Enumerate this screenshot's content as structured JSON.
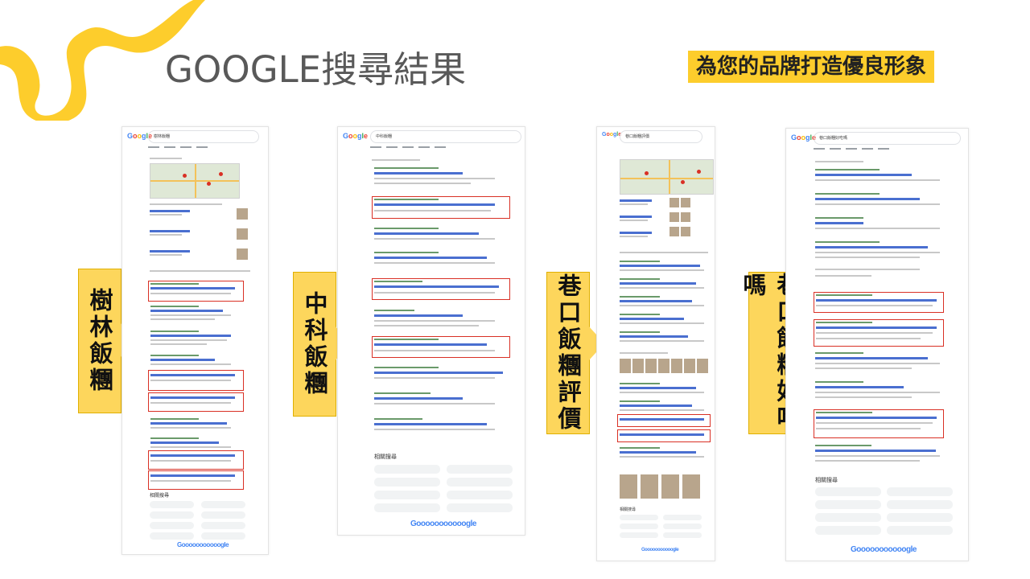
{
  "header": {
    "title": "GOOGLE搜尋結果",
    "tagline": "為您的品牌打造優良形象"
  },
  "colors": {
    "accent": "#fdcd2c",
    "label_fill": "#fdd65c",
    "highlight": "#d93025"
  },
  "panels": [
    {
      "label": "樹林飯糰",
      "search_query": "樹林飯糰"
    },
    {
      "label": "中科飯糰",
      "search_query": "中科飯糰"
    },
    {
      "label": "巷口飯糰評價",
      "search_query": "巷口飯糰評價"
    },
    {
      "label": "巷口飯糰好吃嗎",
      "search_query": "巷口飯糰好吃嗎"
    }
  ],
  "google_logo": "Google",
  "footer_logo": "Gooooooooooogle",
  "related_searches": "相關搜尋"
}
